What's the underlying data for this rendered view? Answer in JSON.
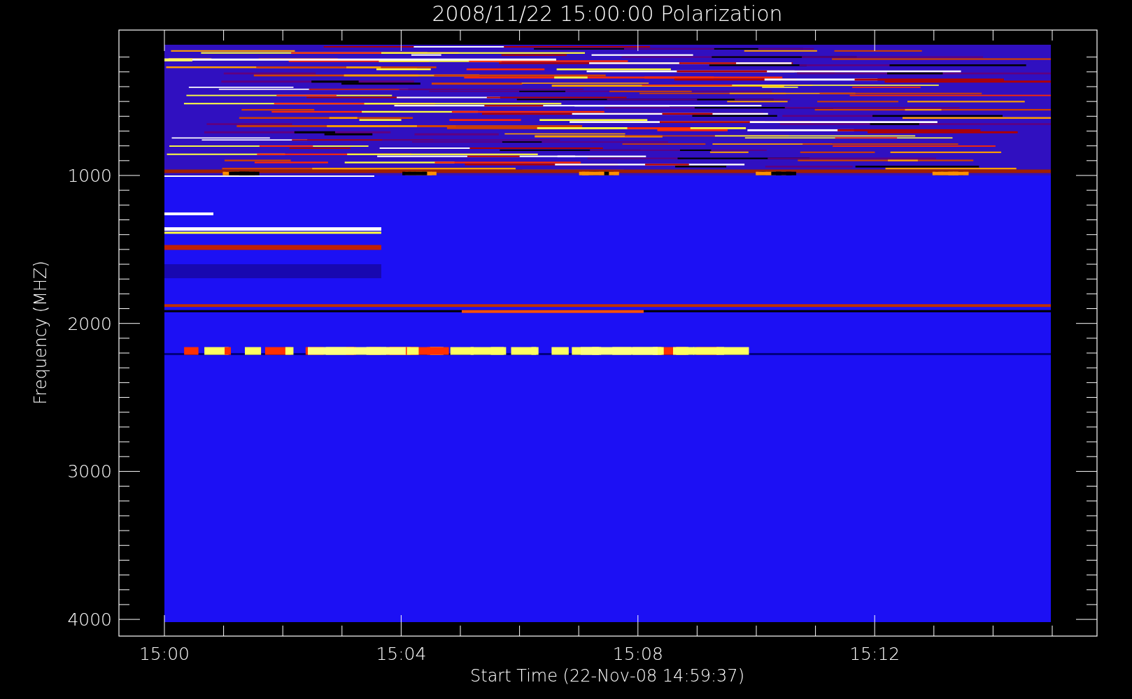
{
  "title": "2008/11/22 15:00:00 Polarization",
  "y_axis": {
    "label": "Frequency (MHZ)",
    "ticks": [
      "1000",
      "2000",
      "3000",
      "4000"
    ]
  },
  "x_axis": {
    "label": "Start Time (22-Nov-08 14:59:37)",
    "ticks": [
      "15:00",
      "15:04",
      "15:08",
      "15:12"
    ]
  }
}
